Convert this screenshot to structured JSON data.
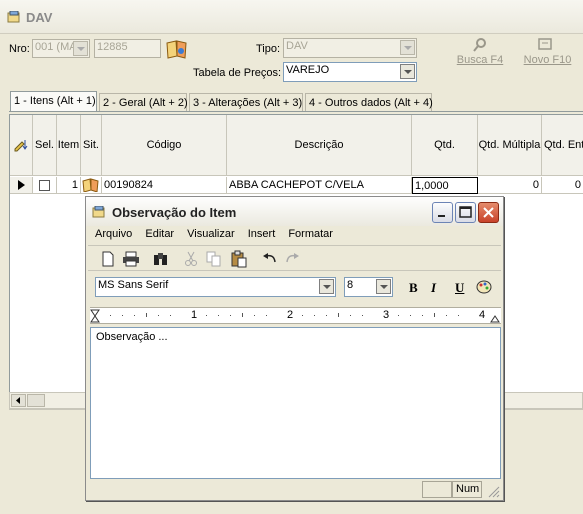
{
  "main": {
    "title": "DAV",
    "nro_label": "Nro:",
    "nro_select": "001 (MA",
    "nro_value": "12885",
    "tipo_label": "Tipo:",
    "tipo_value": "DAV",
    "tabela_label": "Tabela de Preços:",
    "tabela_value": "VAREJO",
    "busca_label": "Busca F4",
    "novo_label": "Novo F10"
  },
  "tabs": [
    {
      "label": "1 - Itens (Alt + 1)"
    },
    {
      "label": "2 - Geral (Alt + 2)"
    },
    {
      "label": "3 - Alterações (Alt + 3)"
    },
    {
      "label": "4 - Outros dados (Alt + 4)"
    }
  ],
  "grid": {
    "headers": [
      "Sel.",
      "Item",
      "Sit.",
      "Código",
      "Descrição",
      "Qtd.",
      "Qtd. Múltipla",
      "Qtd. Ent"
    ],
    "row": {
      "item": "1",
      "codigo": "00190824",
      "descricao": "ABBA CACHEPOT C/VELA",
      "qtd": "1,0000",
      "qtd_multipla": "0",
      "qtd_ent": "0"
    }
  },
  "dialog": {
    "title": "Observação do Item",
    "menu": [
      "Arquivo",
      "Editar",
      "Visualizar",
      "Insert",
      "Formatar"
    ],
    "font_name": "MS Sans Serif",
    "font_size": "8",
    "bold_glyph": "B",
    "italic_glyph": "I",
    "underline_glyph": "U",
    "ruler_numbers": [
      "1",
      "2",
      "3",
      "4"
    ],
    "text": "Observação ...",
    "status_num": "Num"
  },
  "colors": {
    "window_bg": "#ece9d8",
    "close_button": "#c8422a",
    "field_border": "#7f9db9"
  }
}
